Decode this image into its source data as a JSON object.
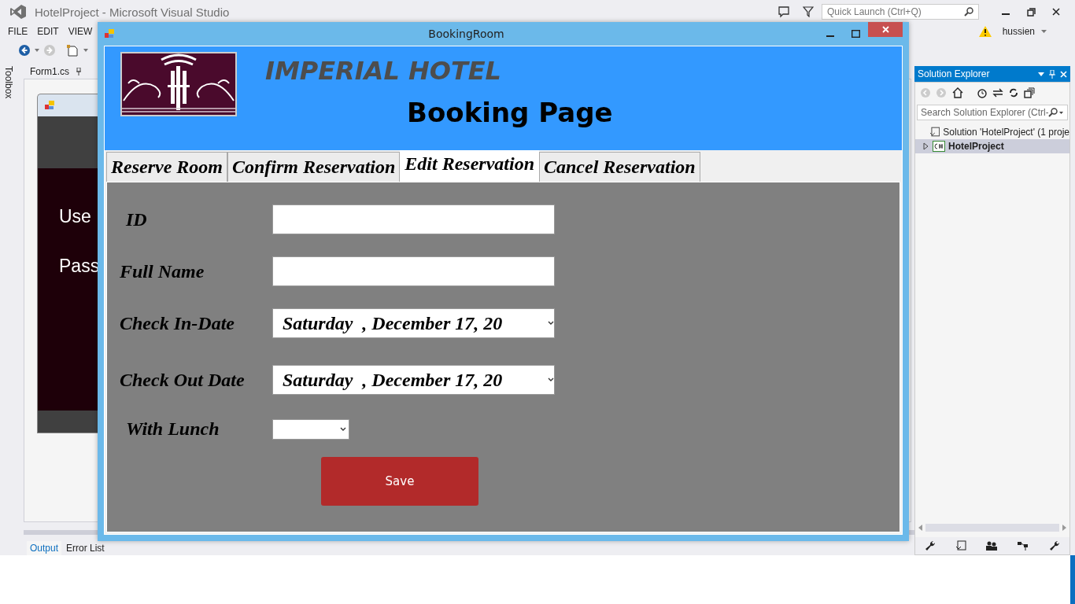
{
  "ide": {
    "title": "HotelProject - Microsoft Visual Studio",
    "menu": [
      "FILE",
      "EDIT",
      "VIEW"
    ],
    "quick_launch": {
      "placeholder": "Quick Launch (Ctrl+Q)"
    },
    "user": "hussien",
    "toolbox_tab": "Toolbox",
    "document_tab": "Form1.cs",
    "designer_form": {
      "labels": [
        "Use",
        "Pass"
      ]
    },
    "bottom_tabs": [
      {
        "label": "Output",
        "selected": true
      },
      {
        "label": "Error List",
        "selected": false
      }
    ]
  },
  "solution_explorer": {
    "title": "Solution Explorer",
    "search": {
      "placeholder": "Search Solution Explorer (Ctrl-"
    },
    "tree": [
      {
        "label": "Solution 'HotelProject' (1 proje",
        "kind": "solution",
        "selected": false,
        "children": [
          {
            "label": "HotelProject",
            "kind": "project",
            "selected": true,
            "expanded": false
          }
        ]
      }
    ]
  },
  "window": {
    "title": "BookingRoom"
  },
  "header": {
    "hotel_name": "IMPERIAL HOTEL",
    "page_title": "Booking Page"
  },
  "tabs": [
    {
      "label": "Reserve Room",
      "selected": false
    },
    {
      "label": "Confirm Reservation",
      "selected": false
    },
    {
      "label": "Edit Reservation",
      "selected": true
    },
    {
      "label": "Cancel Reservation",
      "selected": false
    }
  ],
  "form": {
    "fields": [
      {
        "label": "ID",
        "kind": "text"
      },
      {
        "label": "Full Name",
        "kind": "text"
      },
      {
        "label": "Check In-Date",
        "kind": "date",
        "value": "Saturday  , December 17, 20"
      },
      {
        "label": "Check Out Date",
        "kind": "date",
        "value": "Saturday  , December 17, 20"
      },
      {
        "label": "With Lunch",
        "kind": "combo"
      }
    ],
    "save_button": "Save"
  }
}
